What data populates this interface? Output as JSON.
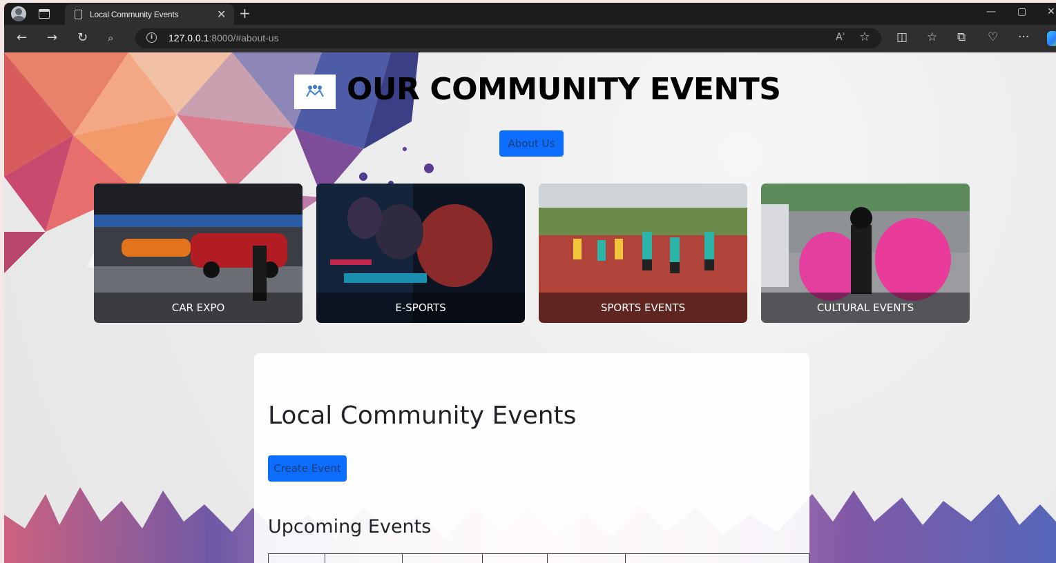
{
  "browser": {
    "tab_title": "Local Community Events",
    "url_host": "127.0.0.1",
    "url_rest": ":8000/#about-us",
    "read_aloud_label": "Aʾ"
  },
  "header": {
    "site_title": "OUR COMMUNITY EVENTS",
    "about_button": "About Us"
  },
  "cards": [
    {
      "label": "CAR EXPO"
    },
    {
      "label": "E-SPORTS"
    },
    {
      "label": "SPORTS EVENTS"
    },
    {
      "label": "CULTURAL EVENTS"
    }
  ],
  "main": {
    "title": "Local Community Events",
    "create_button": "Create Event",
    "upcoming_heading": "Upcoming Events"
  },
  "colors": {
    "primary": "#0d6efd",
    "title_text": "#000000"
  }
}
